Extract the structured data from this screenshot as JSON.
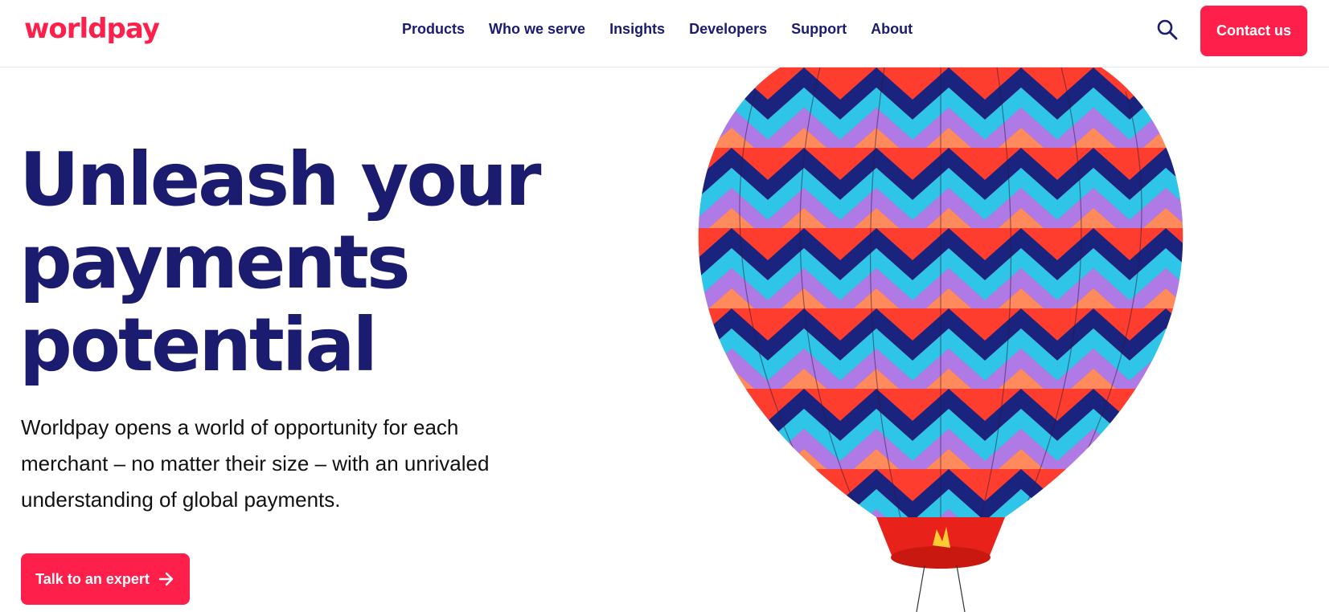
{
  "brand": {
    "logo_text": "worldpay",
    "accent_color": "#ff1f4b",
    "text_color": "#1b1b6f"
  },
  "nav": {
    "items": [
      {
        "label": "Products"
      },
      {
        "label": "Who we serve"
      },
      {
        "label": "Insights"
      },
      {
        "label": "Developers"
      },
      {
        "label": "Support"
      },
      {
        "label": "About"
      }
    ],
    "search_icon": "search-icon",
    "contact_label": "Contact us"
  },
  "hero": {
    "title_lines": [
      "Unleash your",
      "payments",
      "potential"
    ],
    "description_lines": [
      "Worldpay opens a world of opportunity for each",
      "merchant – no matter their size – with an unrivaled",
      "understanding of global payments."
    ],
    "cta_label": "Talk to an expert",
    "cta_icon": "arrow-right-icon",
    "image": "hot-air-balloon"
  }
}
